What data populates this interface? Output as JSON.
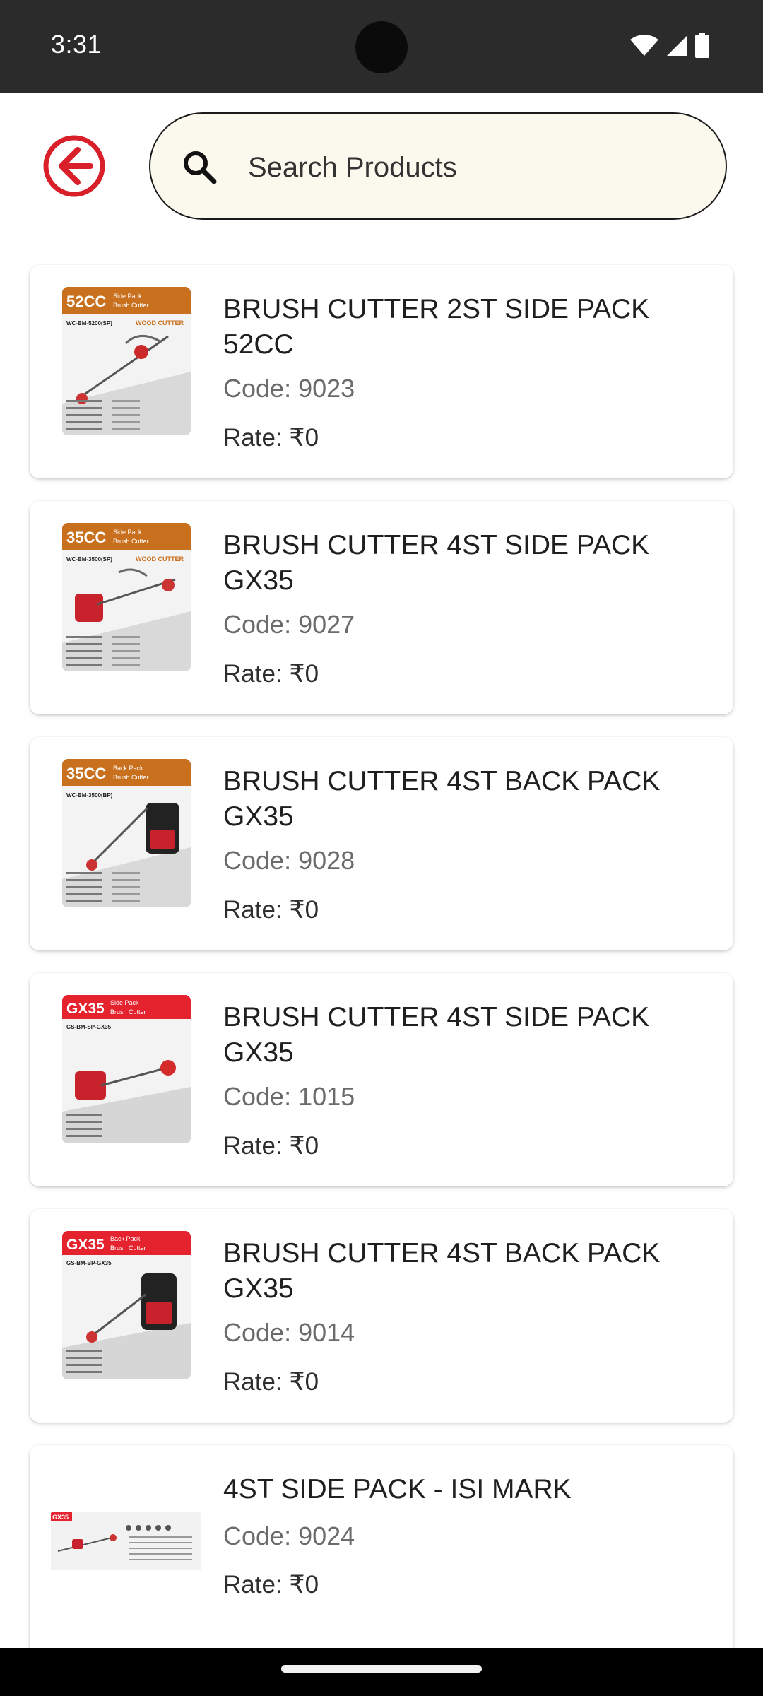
{
  "status_bar": {
    "time": "3:31"
  },
  "search": {
    "placeholder": "Search Products",
    "value": ""
  },
  "colors": {
    "accent": "#d91f2a",
    "search_bg": "#fbf9ee",
    "brand_orange": "#c9701e",
    "brand_red": "#e5232f"
  },
  "products": [
    {
      "title": "BRUSH CUTTER 2ST SIDE PACK 52CC",
      "code": "Code: 9023",
      "rate": "Rate: ₹0",
      "thumb": {
        "badge": "52CC",
        "subtitle1": "Side Pack",
        "subtitle2": "Brush Cutter",
        "model": "WC-BM-5200(SP)",
        "brand": "WOOD CUTTER"
      }
    },
    {
      "title": "BRUSH CUTTER 4ST SIDE PACK GX35",
      "code": "Code: 9027",
      "rate": "Rate: ₹0",
      "thumb": {
        "badge": "35CC",
        "subtitle1": "Side Pack",
        "subtitle2": "Brush Cutter",
        "model": "WC-BM-3500(SP)",
        "brand": "WOOD CUTTER"
      }
    },
    {
      "title": "BRUSH CUTTER 4ST BACK PACK GX35",
      "code": "Code: 9028",
      "rate": "Rate: ₹0",
      "thumb": {
        "badge": "35CC",
        "subtitle1": "Back Pack",
        "subtitle2": "Brush Cutter",
        "model": "WC-BM-3500(BP)",
        "brand": ""
      }
    },
    {
      "title": "BRUSH CUTTER 4ST SIDE PACK GX35",
      "code": "Code: 1015",
      "rate": "Rate: ₹0",
      "thumb": {
        "badge": "GX35",
        "subtitle1": "Side Pack",
        "subtitle2": "Brush Cutter",
        "model": "GS-BM-SP-GX35",
        "brand": ""
      }
    },
    {
      "title": "BRUSH CUTTER 4ST BACK PACK GX35",
      "code": "Code: 9014",
      "rate": "Rate: ₹0",
      "thumb": {
        "badge": "GX35",
        "subtitle1": "Back Pack",
        "subtitle2": "Brush Cutter",
        "model": "GS-BM-BP-GX35",
        "brand": ""
      }
    },
    {
      "title": "4ST SIDE PACK - ISI MARK",
      "code": "Code: 9024",
      "rate": "Rate: ₹0",
      "thumb": {
        "badge": "GX35",
        "subtitle1": "",
        "subtitle2": "",
        "model": "",
        "brand": ""
      }
    }
  ]
}
